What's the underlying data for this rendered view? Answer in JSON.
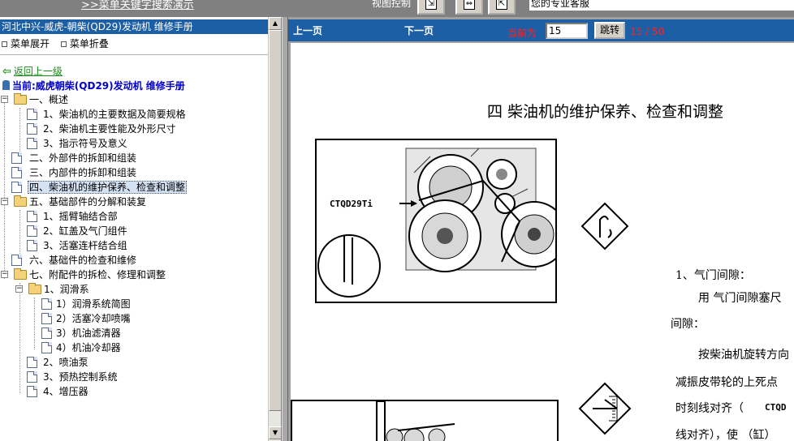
{
  "topbar": {
    "demo_link": ">>菜单关键字搜索演示",
    "view_control": "视图控制",
    "button_glyphs": [
      "⇲",
      "⇔",
      "⇱"
    ],
    "context_text": "您的专业客服"
  },
  "left_panel": {
    "title": "河北中兴-威虎-朝柴(QD29)发动机 维修手册",
    "expand_label": "菜单展开",
    "collapse_label": "菜单折叠",
    "back_link": "返回上一级",
    "current_label": "当前:威虎朝柴(QD29)发动机 维修手册",
    "tree": [
      {
        "label": "一、概述",
        "level": 0,
        "type": "folder",
        "expanded": true
      },
      {
        "label": "1、柴油机的主要数据及简要规格",
        "level": 1,
        "type": "doc"
      },
      {
        "label": "2、柴油机主要性能及外形尺寸",
        "level": 1,
        "type": "doc"
      },
      {
        "label": "3、指示符号及意义",
        "level": 1,
        "type": "doc"
      },
      {
        "label": "二、外部件的拆卸和组装",
        "level": 0,
        "type": "doc"
      },
      {
        "label": "三、内部件的拆卸和组装",
        "level": 0,
        "type": "doc"
      },
      {
        "label": "四、柴油机的维护保养、检查和调整",
        "level": 0,
        "type": "doc",
        "selected": true
      },
      {
        "label": "五、基础部件的分解和装复",
        "level": 0,
        "type": "folder",
        "expanded": true
      },
      {
        "label": "1、摇臂轴结合部",
        "level": 1,
        "type": "doc"
      },
      {
        "label": "2、缸盖及气门组件",
        "level": 1,
        "type": "doc"
      },
      {
        "label": "3、活塞连杆结合组",
        "level": 1,
        "type": "doc"
      },
      {
        "label": "六、基础件的检查和维修",
        "level": 0,
        "type": "doc"
      },
      {
        "label": "七、附配件的拆检、修理和调整",
        "level": 0,
        "type": "folder",
        "expanded": true
      },
      {
        "label": "1、润滑系",
        "level": 1,
        "type": "folder",
        "expanded": true
      },
      {
        "label": "1）润滑系统简图",
        "level": 2,
        "type": "doc"
      },
      {
        "label": "2）活塞冷却喷嘴",
        "level": 2,
        "type": "doc"
      },
      {
        "label": "3）机油滤清器",
        "level": 2,
        "type": "doc"
      },
      {
        "label": "4）机油冷却器",
        "level": 2,
        "type": "doc"
      },
      {
        "label": "2、喷油泵",
        "level": 1,
        "type": "doc"
      },
      {
        "label": "3、预热控制系统",
        "level": 1,
        "type": "doc"
      },
      {
        "label": "4、增压器",
        "level": 1,
        "type": "doc"
      }
    ]
  },
  "nav": {
    "prev": "上一页",
    "next": "下一页",
    "current_label": "当前为",
    "current_page": "15",
    "jump_button": "跳转",
    "page_count": "15 / 50"
  },
  "doc": {
    "heading": "四 柴油机的维护保养、检查和调整",
    "fig_label": "CTQD29Ti",
    "section_title": "1、气门间隙：",
    "line1": "用 气门间隙塞尺",
    "line2": "间隙：",
    "line3": "按柴油机旋转方向",
    "line4": "减振皮带轮的上死点",
    "line5": "时刻线对齐（",
    "inline_label": "CTQD",
    "line6": "线对齐），使 （缸）"
  },
  "colors": {
    "title_bar": "#1c5fa5",
    "nav_text_red": "#ff2020",
    "link_green": "#1a8a1a",
    "current_blue": "#0000cc"
  }
}
